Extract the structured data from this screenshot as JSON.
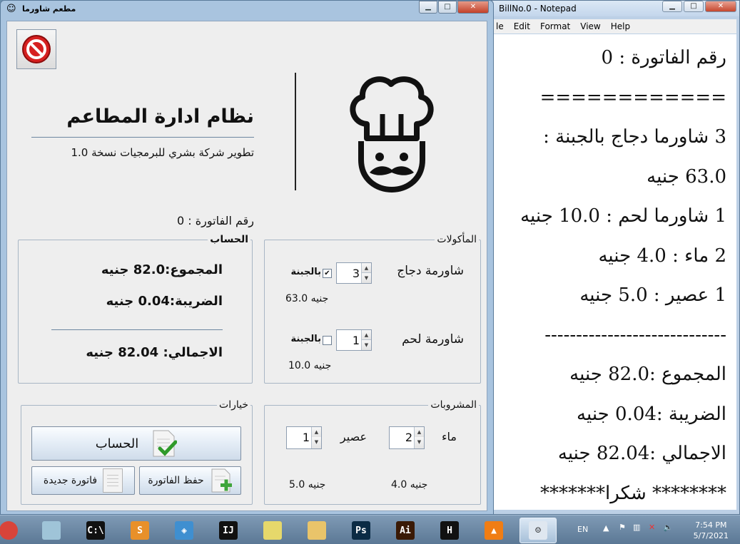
{
  "notepad": {
    "title": "BillNo.0 - Notepad",
    "menu": [
      "le",
      "Edit",
      "Format",
      "View",
      "Help"
    ],
    "lines": [
      "رقم الفاتورة : 0",
      "============",
      "3 شاورما دجاج بالجبنة :",
      "63.0 جنيه",
      "1 شاورما لحم  : 10.0 جنيه",
      "2 ماء  : 4.0 جنيه",
      "1 عصير  : 5.0 جنيه",
      "-----------------------------",
      "المجموع :82.0 جنيه",
      "الضريبة :0.04 جنيه",
      "الاجمالي :82.04 جنيه",
      "******** شكرا*******"
    ]
  },
  "window": {
    "title": "مطعم شاورما",
    "minimize": "▁",
    "maximize": "□",
    "close": "✕"
  },
  "header": {
    "title": "نظام ادارة المطاعم",
    "subtitle": "تطوير شركة بشري للبرمجيات نسخة 1.0",
    "invoice_label": "رقم الفاتورة : 0"
  },
  "food": {
    "legend": "المأكولات",
    "items": [
      {
        "name": "شاورمة دجاج",
        "qty": "3",
        "cheese_label": "بالجبنة",
        "cheese_checked": "✔",
        "price": "63.0 جنيه"
      },
      {
        "name": "شاورمة لحم",
        "qty": "1",
        "cheese_label": "بالجبنة",
        "cheese_checked": "",
        "price": "10.0 جنيه"
      }
    ]
  },
  "account": {
    "legend": "الحساب",
    "subtotal": "المجموع:82.0 جنيه",
    "tax": "الضريبة:0.04 جنيه",
    "total": "الاجمالي: 82.04 جنيه"
  },
  "drinks": {
    "legend": "المشروبات",
    "items": [
      {
        "name": "ماء",
        "qty": "2",
        "price": "4.0 جنيه"
      },
      {
        "name": "عصير",
        "qty": "1",
        "price": "5.0 جنيه"
      }
    ]
  },
  "options": {
    "legend": "خيارات",
    "calc_label": "الحساب",
    "save_label": "حفظ الفاتورة",
    "new_label": "فاتورة جديدة"
  },
  "taskbar": {
    "lang": "EN",
    "time": "7:54 PM",
    "date": "5/7/2021",
    "apps": [
      {
        "name": "chrome-icon",
        "glyph": "",
        "color": "#d8443a"
      },
      {
        "name": "notes-icon",
        "glyph": "",
        "color": "#9fc4d8"
      },
      {
        "name": "cmd-icon",
        "glyph": "C:\\",
        "color": "#111111"
      },
      {
        "name": "sublime-icon",
        "glyph": "S",
        "color": "#e8902a"
      },
      {
        "name": "netbeans-icon",
        "glyph": "◈",
        "color": "#3f8fd0"
      },
      {
        "name": "intellij-icon",
        "glyph": "IJ",
        "color": "#111111"
      },
      {
        "name": "stickynotes-icon",
        "glyph": "",
        "color": "#e6d86b"
      },
      {
        "name": "explorer-icon",
        "glyph": "",
        "color": "#e9c46a"
      },
      {
        "name": "photoshop-icon",
        "glyph": "Ps",
        "color": "#0b2b45"
      },
      {
        "name": "illustrator-icon",
        "glyph": "Ai",
        "color": "#3a1a06"
      },
      {
        "name": "hyper-icon",
        "glyph": "H",
        "color": "#111111"
      },
      {
        "name": "vlc-icon",
        "glyph": "▲",
        "color": "#f07d14"
      },
      {
        "name": "java-app-icon",
        "glyph": "☺",
        "color": "#dfe7f0"
      }
    ]
  }
}
